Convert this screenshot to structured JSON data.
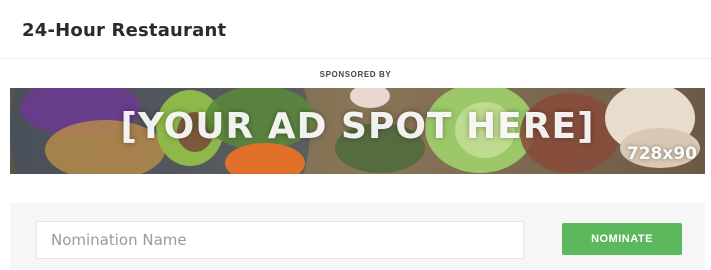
{
  "widget": {
    "title": "24-Hour Restaurant",
    "sponsored_label": "SPONSORED BY"
  },
  "ad": {
    "headline": "[YOUR AD SPOT HERE]",
    "size_label": "728x90",
    "image_subject": "food-bowls-photo"
  },
  "nomination": {
    "placeholder": "Nomination Name",
    "value": "",
    "button_label": "NOMINATE"
  },
  "colors": {
    "accent_button": "#5cb85c",
    "title_text": "#2b2b2b",
    "form_background": "#f6f6f6"
  }
}
